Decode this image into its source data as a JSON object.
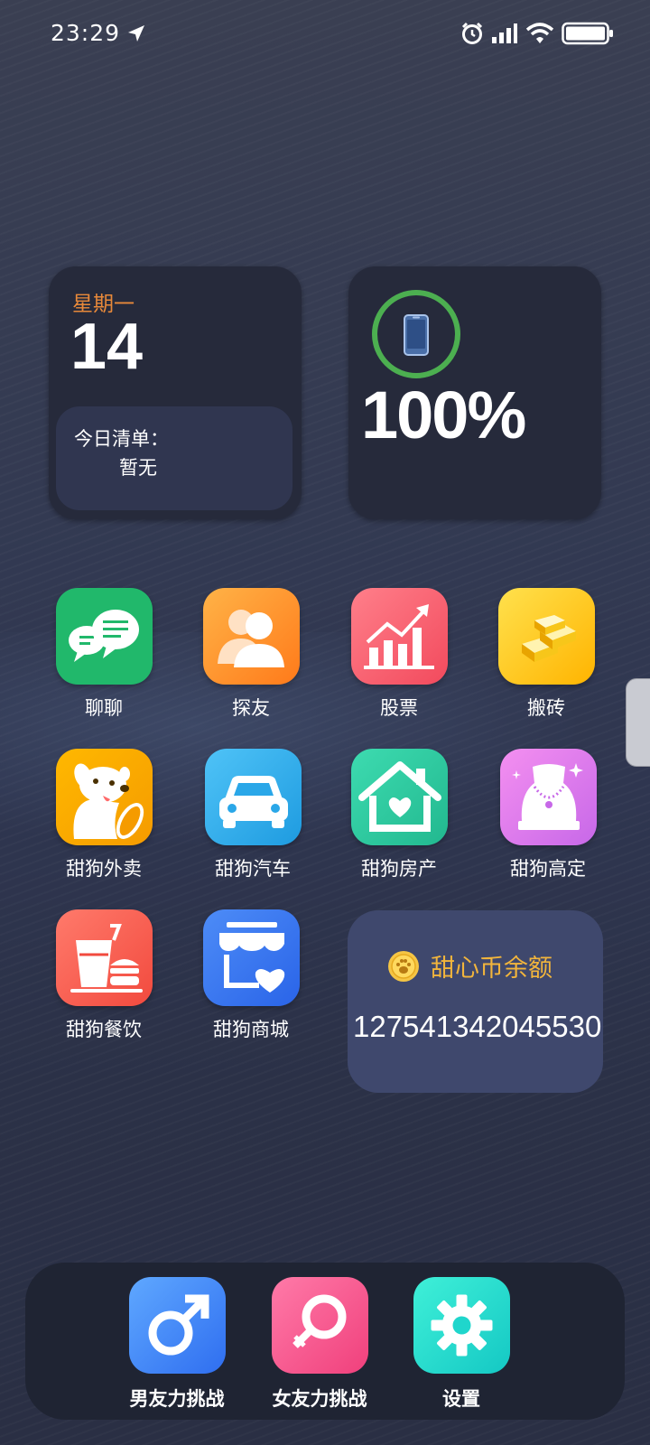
{
  "status_bar": {
    "time": "23:29",
    "icons": [
      "location-arrow-icon",
      "alarm-icon",
      "signal-icon",
      "wifi-icon",
      "battery-icon"
    ]
  },
  "date_widget": {
    "weekday": "星期一",
    "day": "14",
    "todo_title": "今日清单：",
    "todo_value": "暂无"
  },
  "battery_widget": {
    "percent_text": "100%",
    "level": 1.0,
    "ring_color": "#4caf50"
  },
  "apps": [
    {
      "label": "聊聊",
      "icon": "chat-icon"
    },
    {
      "label": "探友",
      "icon": "friends-icon"
    },
    {
      "label": "股票",
      "icon": "stock-chart-icon"
    },
    {
      "label": "搬砖",
      "icon": "gold-bars-icon"
    },
    {
      "label": "甜狗外卖",
      "icon": "dog-delivery-icon"
    },
    {
      "label": "甜狗汽车",
      "icon": "car-icon"
    },
    {
      "label": "甜狗房产",
      "icon": "house-heart-icon"
    },
    {
      "label": "甜狗高定",
      "icon": "necklace-icon"
    },
    {
      "label": "甜狗餐饮",
      "icon": "food-drink-icon"
    },
    {
      "label": "甜狗商城",
      "icon": "store-heart-icon"
    }
  ],
  "coin_widget": {
    "title": "甜心币余额",
    "amount": "127541342045530",
    "title_color": "#f2b53c"
  },
  "dock": [
    {
      "label": "男友力挑战",
      "icon": "male-symbol-icon"
    },
    {
      "label": "女友力挑战",
      "icon": "female-symbol-icon"
    },
    {
      "label": "设置",
      "icon": "gear-icon"
    }
  ]
}
